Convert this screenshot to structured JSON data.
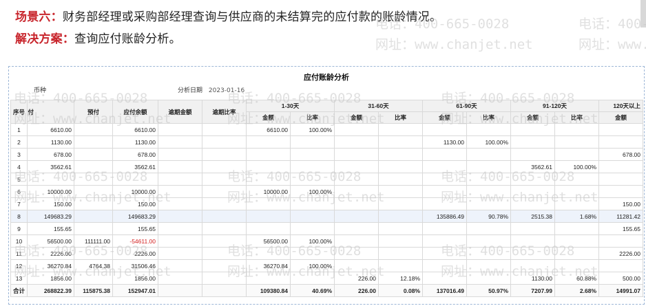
{
  "scene6": {
    "key": "场景六：",
    "text": "财务部经理或采购部经理查询与供应商的未结算完的应付款的账龄情况。"
  },
  "solution": {
    "key": "解决方案：",
    "text": "查询应付账龄分析。"
  },
  "watermark": {
    "phone": "电话：400-665-0028",
    "site": "网址：www.chanjet.net"
  },
  "report": {
    "title": "应付账龄分析",
    "currency_label": "币种",
    "date_label": "分析日期",
    "date_value": "2023-01-16",
    "headers": {
      "seq": "序号",
      "payable": "应付",
      "prepaid": "预付",
      "balance": "应付余额",
      "overdue_amount": "逾期金额",
      "overdue_ratio": "逾期比率",
      "b1": "1-30天",
      "b2": "31-60天",
      "b3": "61-90天",
      "b4": "91-120天",
      "b5": "120天以上",
      "amount": "金额",
      "ratio": "比率"
    },
    "rows": [
      [
        "1",
        "6610.00",
        "",
        "6610.00",
        "",
        "",
        "6610.00",
        "100.00%",
        "",
        "",
        "",
        "",
        "",
        "",
        ""
      ],
      [
        "2",
        "1130.00",
        "",
        "1130.00",
        "",
        "",
        "",
        "",
        "",
        "",
        "1130.00",
        "100.00%",
        "",
        "",
        ""
      ],
      [
        "3",
        "678.00",
        "",
        "678.00",
        "",
        "",
        "",
        "",
        "",
        "",
        "",
        "",
        "",
        "",
        "678.00"
      ],
      [
        "4",
        "3562.61",
        "",
        "3562.61",
        "",
        "",
        "",
        "",
        "",
        "",
        "",
        "",
        "3562.61",
        "100.00%",
        ""
      ],
      [
        "5",
        "",
        "",
        "",
        "",
        "",
        "",
        "",
        "",
        "",
        "",
        "",
        "",
        "",
        ""
      ],
      [
        "6",
        "10000.00",
        "",
        "10000.00",
        "",
        "",
        "10000.00",
        "100.00%",
        "",
        "",
        "",
        "",
        "",
        "",
        ""
      ],
      [
        "7",
        "150.00",
        "",
        "150.00",
        "",
        "",
        "",
        "",
        "",
        "",
        "",
        "",
        "",
        "",
        "150.00"
      ],
      [
        "8",
        "149683.29",
        "",
        "149683.29",
        "",
        "",
        "",
        "",
        "",
        "",
        "135886.49",
        "90.78%",
        "2515.38",
        "1.68%",
        "11281.42"
      ],
      [
        "9",
        "155.65",
        "",
        "155.65",
        "",
        "",
        "",
        "",
        "",
        "",
        "",
        "",
        "",
        "",
        "155.65"
      ],
      [
        "10",
        "56500.00",
        "111111.00",
        "-54611.00",
        "",
        "",
        "56500.00",
        "100.00%",
        "",
        "",
        "",
        "",
        "",
        "",
        ""
      ],
      [
        "11",
        "2226.00",
        "",
        "2226.00",
        "",
        "",
        "",
        "",
        "",
        "",
        "",
        "",
        "",
        "",
        "2226.00"
      ],
      [
        "12",
        "36270.84",
        "4764.38",
        "31506.46",
        "",
        "",
        "36270.84",
        "100.00%",
        "",
        "",
        "",
        "",
        "",
        "",
        ""
      ],
      [
        "13",
        "1856.00",
        "",
        "1856.00",
        "",
        "",
        "",
        "",
        "226.00",
        "12.18%",
        "",
        "",
        "1130.00",
        "60.88%",
        "500.00"
      ]
    ],
    "total": [
      "合计",
      "268822.39",
      "115875.38",
      "152947.01",
      "",
      "",
      "109380.84",
      "40.69%",
      "226.00",
      "0.08%",
      "137016.49",
      "50.97%",
      "7207.99",
      "2.68%",
      "14991.07"
    ]
  }
}
